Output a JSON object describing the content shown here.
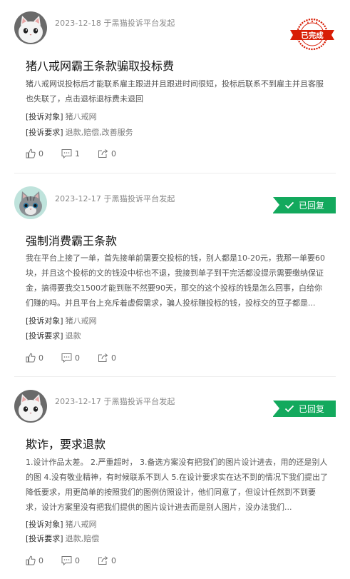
{
  "complaints": [
    {
      "meta": "2023-12-18 于黑猫投诉平台发起",
      "status": "已完成",
      "title": "猪八戒网霸王条款骗取投标费",
      "description": "猪八戒网说投标后才能联系雇主跟进并且跟进时间很短，投标后联系不到雇主并且客服也失联了，点击退标退标费未退回",
      "target_label": "[投诉对象]",
      "target_value": "猪八戒网",
      "request_label": "[投诉要求]",
      "request_value": "退款,赔偿,改善服务",
      "likes": "0",
      "comments": "1",
      "shares": "0",
      "avatar_icon": "white-cat-avatar-icon"
    },
    {
      "meta": "2023-12-17 于黑猫投诉平台发起",
      "status": "已回复",
      "title": "强制消费霸王条款",
      "description": "我在平台上接了一单，首先接单前需要交投标的钱，别人都是10-20元，我那一单要60块，并且这个投标的文的钱没中标也不退，我接到单子到干完活都没提示需要缴纳保证金，搞得要我交1500才能到账不然要90天，那交的这个投标的钱是怎么回事，白给你们赚的吗。并且平台上充斥着虚假需求，骗人投标赚投标的钱，投标交的豆子都是...",
      "target_label": "[投诉对象]",
      "target_value": "猪八戒网",
      "request_label": "[投诉要求]",
      "request_value": "退款",
      "likes": "0",
      "comments": "0",
      "shares": "0",
      "avatar_icon": "grey-cat-avatar-icon"
    },
    {
      "meta": "2023-12-17 于黑猫投诉平台发起",
      "status": "已回复",
      "title": "欺诈，要求退款",
      "description": "1.设计作品太差。 2.严重超时， 3.备选方案没有把我们的图片设计进去，用的还是别人的图 4.没有敬业精神，有时候联系不到人 5.在设计要求实在达不到的情况下我们提出了降低要求，用更简单的按照我们的图例仿照设计，他们同意了，但设计任然到不到要求，设计方案里没有把我们提供的图片设计进去而是别人图片，没办法我们...",
      "target_label": "[投诉对象]",
      "target_value": "猪八戒网",
      "request_label": "[投诉要求]",
      "request_value": "退款,赔偿",
      "likes": "0",
      "comments": "0",
      "shares": "0",
      "avatar_icon": "white-cat-avatar-icon"
    }
  ],
  "colors": {
    "reply_badge": "#13a95d",
    "stamp_red": "#d81e06"
  }
}
